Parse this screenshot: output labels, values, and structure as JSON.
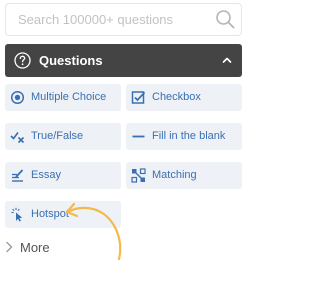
{
  "search": {
    "placeholder": "Search 100000+ questions",
    "value": ""
  },
  "panel": {
    "title": "Questions"
  },
  "question_types": [
    {
      "label": "Multiple Choice",
      "icon": "radio-icon"
    },
    {
      "label": "Checkbox",
      "icon": "checkbox-icon"
    },
    {
      "label": "True/False",
      "icon": "true-false-icon"
    },
    {
      "label": "Fill in the blank",
      "icon": "blank-line-icon"
    },
    {
      "label": "Essay",
      "icon": "essay-icon"
    },
    {
      "label": "Matching",
      "icon": "matching-icon"
    },
    {
      "label": "Hotspot",
      "icon": "hotspot-icon"
    }
  ],
  "more": {
    "label": "More"
  },
  "colors": {
    "accent": "#3a6fb3",
    "header_bg": "#444444",
    "tile_bg": "#eef2f6",
    "annotation_arrow": "#f5b94a"
  }
}
